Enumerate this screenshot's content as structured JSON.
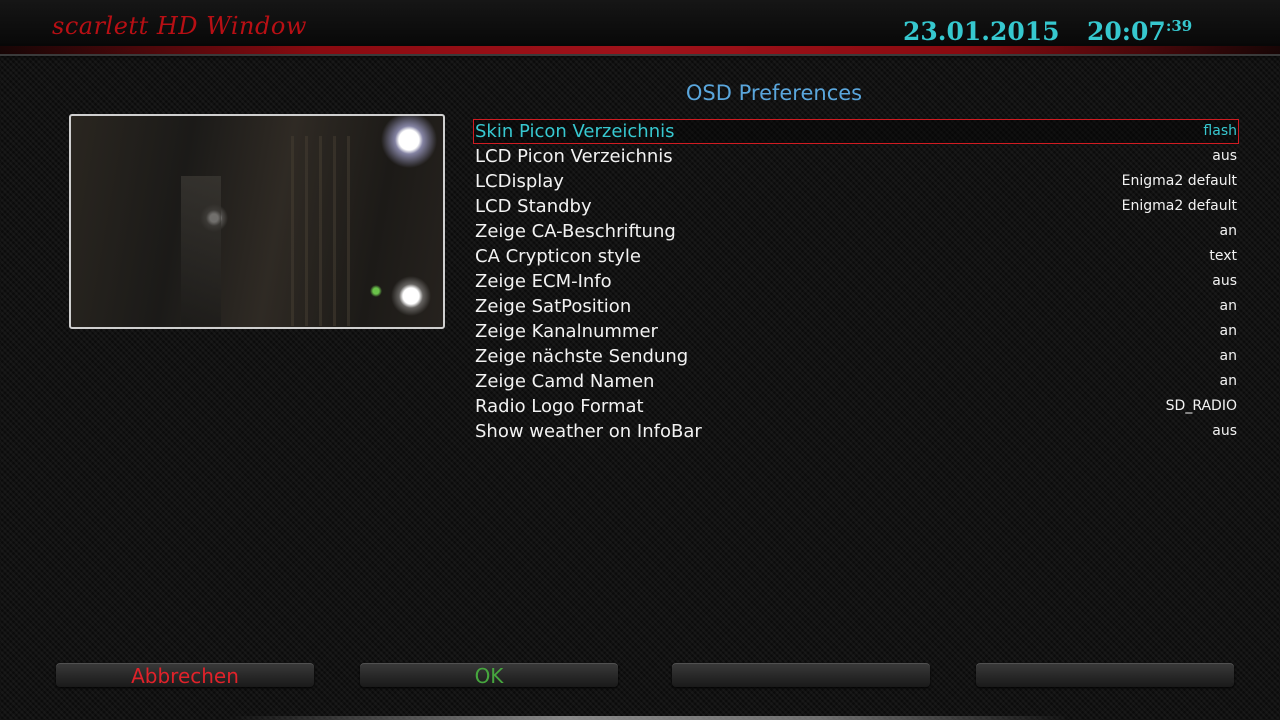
{
  "header": {
    "window_title": "scarlett HD Window",
    "date": "23.01.2015",
    "time": "20:07",
    "seconds": ":39"
  },
  "page_title": "OSD Preferences",
  "settings": [
    {
      "label": "Skin Picon Verzeichnis",
      "value": "flash",
      "selected": true
    },
    {
      "label": "LCD Picon Verzeichnis",
      "value": "aus"
    },
    {
      "label": "LCDisplay",
      "value": "Enigma2 default"
    },
    {
      "label": "LCD Standby",
      "value": "Enigma2 default"
    },
    {
      "label": "Zeige CA-Beschriftung",
      "value": "an"
    },
    {
      "label": "CA Crypticon style",
      "value": "text"
    },
    {
      "label": "Zeige ECM-Info",
      "value": "aus"
    },
    {
      "label": "Zeige SatPosition",
      "value": "an"
    },
    {
      "label": "Zeige Kanalnummer",
      "value": "an"
    },
    {
      "label": "Zeige nächste Sendung",
      "value": "an"
    },
    {
      "label": "Zeige Camd Namen",
      "value": "an"
    },
    {
      "label": "Radio Logo Format",
      "value": "SD_RADIO"
    },
    {
      "label": "Show weather on InfoBar",
      "value": "aus"
    }
  ],
  "buttons": {
    "red": "Abbrechen",
    "green": "OK",
    "yellow": "",
    "blue": ""
  },
  "colors": {
    "accent_cyan": "#37c8d0",
    "title_blue": "#5aa6dc",
    "red": "#e0222a",
    "green": "#46a63e",
    "header_red": "#b80f14"
  }
}
